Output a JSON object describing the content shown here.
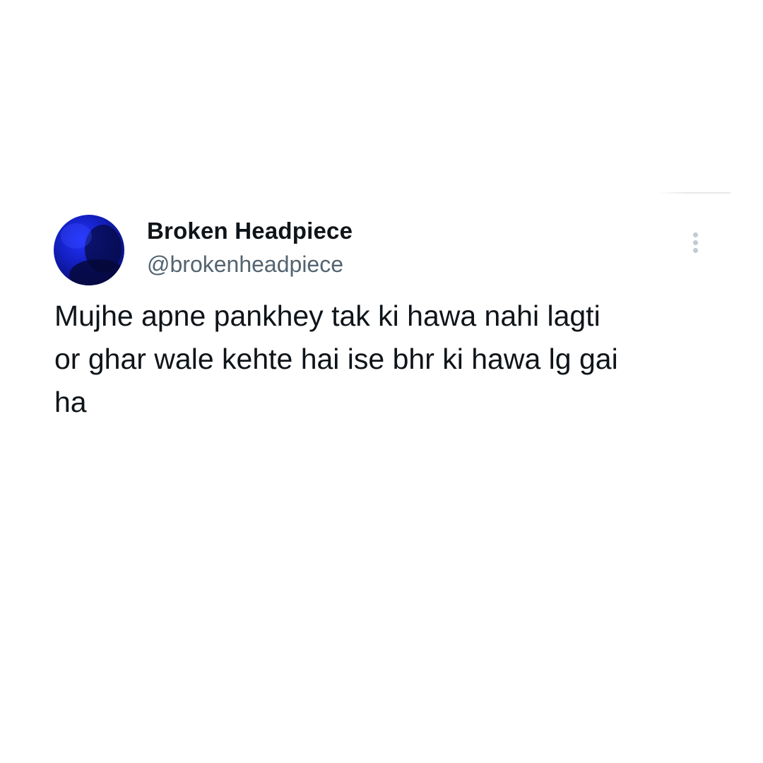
{
  "tweet": {
    "author": {
      "display_name": "Broken Headpiece",
      "handle": "@brokenheadpiece",
      "avatar_icon": "profile-avatar",
      "avatar_color": "#1a26d6"
    },
    "more_icon": "more-vertical-icon",
    "text_lines": [
      "Mujhe apne pankhey tak ki hawa nahi lagti",
      "or ghar wale kehte hai ise bhr ki hawa lg gai",
      "ha"
    ]
  }
}
